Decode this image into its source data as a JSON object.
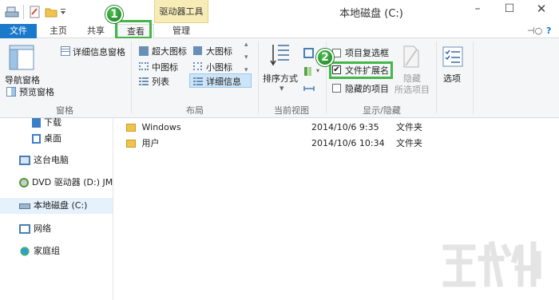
{
  "window": {
    "title": "本地磁盘 (C:)",
    "context_tab_group": "驱动器工具"
  },
  "tabs": {
    "file": "文件",
    "home": "主页",
    "share": "共享",
    "view": "查看",
    "manage": "管理"
  },
  "ribbon": {
    "panes": {
      "navigation_pane": "导航窗格",
      "preview_pane": "预览窗格",
      "details_pane": "详细信息窗格",
      "group_label": "窗格"
    },
    "layout": {
      "extra_large_icons": "超大图标",
      "large_icons": "大图标",
      "medium_icons": "中图标",
      "small_icons": "小图标",
      "list": "列表",
      "details": "详细信息",
      "group_label": "布局"
    },
    "current_view": {
      "sort_by": "排序方式",
      "group_label": "当前视图"
    },
    "show_hide": {
      "item_checkboxes": "项目复选框",
      "file_extensions": "文件扩展名",
      "hidden_items": "隐藏的项目",
      "hide_line1": "隐藏",
      "hide_line2": "所选项目",
      "group_label": "显示/隐藏",
      "item_checkboxes_checked": false,
      "file_extensions_checked": true,
      "hidden_items_checked": false
    },
    "options": "选项"
  },
  "callouts": {
    "one": "1",
    "two": "2"
  },
  "nav": {
    "downloads": "下载",
    "desktop": "桌面",
    "this_pc": "这台电脑",
    "dvd": "DVD 驱动器 (D:) JM",
    "local_disk": "本地磁盘 (C:)",
    "network": "网络",
    "homegroup": "家庭组"
  },
  "files": [
    {
      "name": "Windows",
      "date": "2014/10/6 9:35",
      "type": "文件夹"
    },
    {
      "name": "用户",
      "date": "2014/10/6 10:34",
      "type": "文件夹"
    }
  ],
  "colors": {
    "file_tab": "#1979ca",
    "highlight": "#45b649",
    "context_tab": "#f7ecb5"
  }
}
